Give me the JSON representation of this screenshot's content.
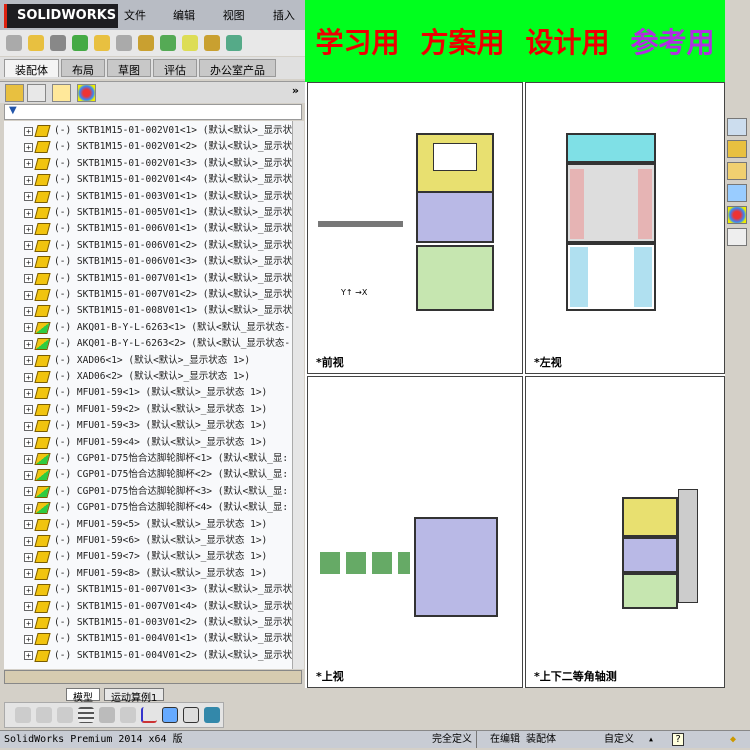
{
  "app": {
    "logo": "SOLIDWORKS",
    "menu": [
      "文件(F)",
      "编辑(E)",
      "视图(V)",
      "插入(I)"
    ]
  },
  "command_tabs": [
    "装配体",
    "布局",
    "草图",
    "评估",
    "办公室产品"
  ],
  "feature_manager": {
    "expand": "»",
    "filter_icon": "filter-icon"
  },
  "tree": [
    {
      "name": "(-) SKTB1M15-01-002V01<1>  (默认<默认>_显示状",
      "icon": "y"
    },
    {
      "name": "(-) SKTB1M15-01-002V01<2>  (默认<默认>_显示状",
      "icon": "y"
    },
    {
      "name": "(-) SKTB1M15-01-002V01<3>  (默认<默认>_显示状",
      "icon": "y"
    },
    {
      "name": "(-) SKTB1M15-01-002V01<4>  (默认<默认>_显示状",
      "icon": "y"
    },
    {
      "name": "(-) SKTB1M15-01-003V01<1>  (默认<默认>_显示状",
      "icon": "y"
    },
    {
      "name": "(-) SKTB1M15-01-005V01<1>  (默认<默认>_显示状",
      "icon": "y"
    },
    {
      "name": "(-) SKTB1M15-01-006V01<1>  (默认<默认>_显示状",
      "icon": "y"
    },
    {
      "name": "(-) SKTB1M15-01-006V01<2>  (默认<默认>_显示状",
      "icon": "y"
    },
    {
      "name": "(-) SKTB1M15-01-006V01<3>  (默认<默认>_显示状",
      "icon": "y"
    },
    {
      "name": "(-) SKTB1M15-01-007V01<1>  (默认<默认>_显示状",
      "icon": "y"
    },
    {
      "name": "(-) SKTB1M15-01-007V01<2>  (默认<默认>_显示状",
      "icon": "y"
    },
    {
      "name": "(-) SKTB1M15-01-008V01<1>  (默认<默认>_显示状",
      "icon": "y"
    },
    {
      "name": "(-) AKQ01-B-Y-L-6263<1>  (默认<默认_显示状态-",
      "icon": "g"
    },
    {
      "name": "(-) AKQ01-B-Y-L-6263<2>  (默认<默认_显示状态-",
      "icon": "g"
    },
    {
      "name": "(-) XAD06<1>  (默认<默认>_显示状态 1>)",
      "icon": "y"
    },
    {
      "name": "(-) XAD06<2>  (默认<默认>_显示状态 1>)",
      "icon": "y"
    },
    {
      "name": "(-) MFU01-59<1>  (默认<默认>_显示状态 1>)",
      "icon": "y"
    },
    {
      "name": "(-) MFU01-59<2>  (默认<默认>_显示状态 1>)",
      "icon": "y"
    },
    {
      "name": "(-) MFU01-59<3>  (默认<默认>_显示状态 1>)",
      "icon": "y"
    },
    {
      "name": "(-) MFU01-59<4>  (默认<默认>_显示状态 1>)",
      "icon": "y"
    },
    {
      "name": "(-) CGP01-D75怡合达脚轮脚杯<1>  (默认<默认_显:",
      "icon": "g"
    },
    {
      "name": "(-) CGP01-D75怡合达脚轮脚杯<2>  (默认<默认_显:",
      "icon": "g"
    },
    {
      "name": "(-) CGP01-D75怡合达脚轮脚杯<3>  (默认<默认_显:",
      "icon": "g"
    },
    {
      "name": "(-) CGP01-D75怡合达脚轮脚杯<4>  (默认<默认_显:",
      "icon": "g"
    },
    {
      "name": "(-) MFU01-59<5>  (默认<默认>_显示状态 1>)",
      "icon": "y"
    },
    {
      "name": "(-) MFU01-59<6>  (默认<默认>_显示状态 1>)",
      "icon": "y"
    },
    {
      "name": "(-) MFU01-59<7>  (默认<默认>_显示状态 1>)",
      "icon": "y"
    },
    {
      "name": "(-) MFU01-59<8>  (默认<默认>_显示状态 1>)",
      "icon": "y"
    },
    {
      "name": "(-) SKTB1M15-01-007V01<3>  (默认<默认>_显示状",
      "icon": "y"
    },
    {
      "name": "(-) SKTB1M15-01-007V01<4>  (默认<默认>_显示状",
      "icon": "y"
    },
    {
      "name": "(-) SKTB1M15-01-003V01<2>  (默认<默认>_显示状",
      "icon": "y"
    },
    {
      "name": "(-) SKTB1M15-01-004V01<1>  (默认<默认>_显示状",
      "icon": "y"
    },
    {
      "name": "(-) SKTB1M15-01-004V01<2>  (默认<默认>_显示状",
      "icon": "y"
    }
  ],
  "banner": [
    "学习用",
    "方案用",
    "设计用",
    "参考用"
  ],
  "views": {
    "front": "*前视",
    "left": "*左视",
    "top": "*上视",
    "iso": "*上下二等角轴测"
  },
  "bottom_tabs": [
    "模型",
    "运动算例1"
  ],
  "status": {
    "product": "SolidWorks Premium 2014 x64 版",
    "state": "完全定义",
    "editing": "在编辑 装配体",
    "units": "自定义",
    "help": "?"
  }
}
